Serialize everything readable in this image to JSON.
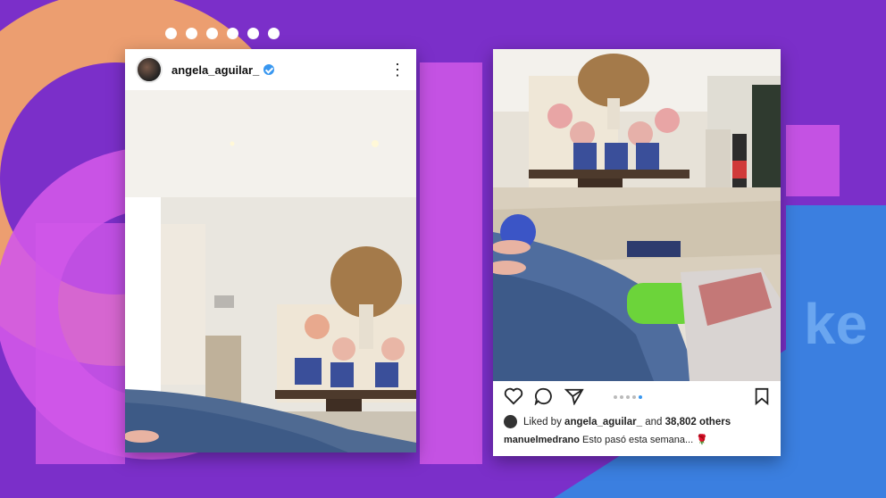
{
  "colors": {
    "background": "#7b2fc9",
    "accent_orange": "#f2a46b",
    "accent_pink": "#d158e8",
    "accent_blue": "#3b7fe0",
    "verified_blue": "#3897f0"
  },
  "post_left": {
    "username": "angela_aguilar_",
    "verified_icon": "verified-badge-icon",
    "more_icon": "more-options-icon"
  },
  "post_right": {
    "icons": [
      "heart-icon",
      "comment-icon",
      "share-icon",
      "bookmark-icon"
    ],
    "carousel_dot_count": 5,
    "carousel_active_index": 4,
    "liked_prefix": "Liked by",
    "liked_user": "angela_aguilar_",
    "liked_and": "and",
    "liked_count": "38,802 others",
    "caption_user": "manuelmedrano",
    "caption_text": "Esto pasó esta semana...",
    "caption_emoji": "🌹"
  }
}
